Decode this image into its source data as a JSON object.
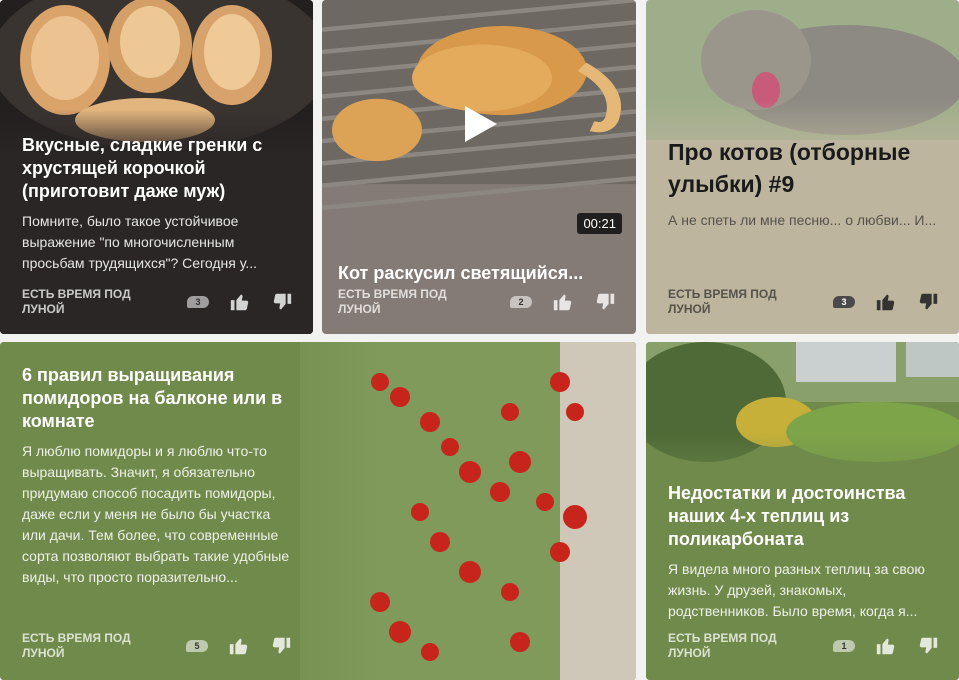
{
  "cards": [
    {
      "title": "Вкусные, сладкие гренки с хрустящей корочкой (приготовит даже муж)",
      "snippet": "Помните, было такое устойчивое выражение \"по многочисленным просьбам трудящихся\"? Сегодня у...",
      "channel": "ЕСТЬ ВРЕМЯ ПОД ЛУНОЙ",
      "comments": "3"
    },
    {
      "title": "Кот раскусил светящийся...",
      "channel": "ЕСТЬ ВРЕМЯ ПОД ЛУНОЙ",
      "comments": "2",
      "duration": "00:21"
    },
    {
      "title": "Про котов (отборные улыбки) #9",
      "snippet": "А не спеть ли мне песню... о любви... И...",
      "channel": "ЕСТЬ ВРЕМЯ ПОД ЛУНОЙ",
      "comments": "3"
    },
    {
      "title": "6 правил выращивания помидоров на балконе или в комнате",
      "snippet": "Я люблю помидоры и я люблю что-то выращивать. Значит, я обязательно придумаю способ посадить помидоры, даже если у меня не было бы участка или дачи. Тем более, что современные сорта позволяют выбрать такие удобные виды, что просто поразительно...",
      "channel": "ЕСТЬ ВРЕМЯ ПОД ЛУНОЙ",
      "comments": "5"
    },
    {
      "title": "Недостатки и достоинства наших 4-х теплиц из поликарбоната",
      "snippet": "Я видела много разных теплиц за свою жизнь. У друзей, знакомых, родственников. Было время, когда я...",
      "channel": "ЕСТЬ ВРЕМЯ ПОД ЛУНОЙ",
      "comments": "1"
    }
  ],
  "icons": {
    "like": "thumb-up-icon",
    "dislike": "thumb-down-icon",
    "comments": "comment-bubble-icon",
    "play": "play-icon"
  },
  "colors": {
    "card1_bg": "#2b2626",
    "card2_bg": "#857b76",
    "card3_bg": "#bdb59e",
    "card4_bg": "#6f8a4a",
    "card5_bg": "#6f8a4a"
  }
}
